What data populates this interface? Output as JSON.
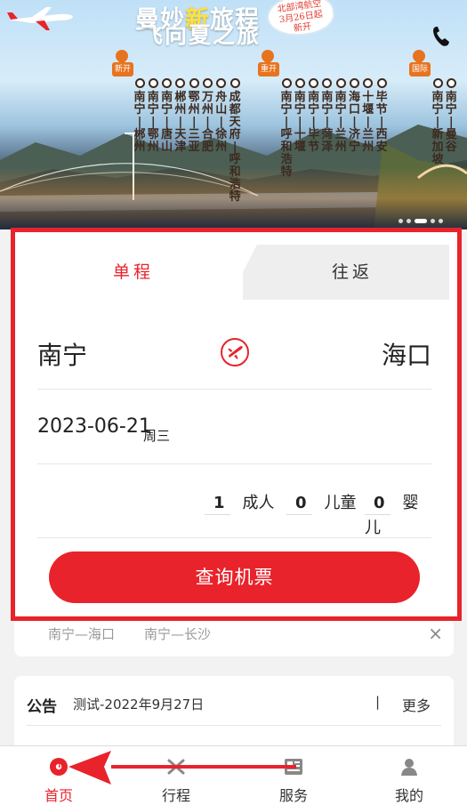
{
  "banner": {
    "slogan_a": "曼妙",
    "slogan_hl": "新",
    "slogan_b": "旅程",
    "slogan_line2": "飞向夏之旅",
    "badge_lines": [
      "北部湾航空",
      "3月26日起",
      "新开"
    ],
    "tags": [
      "新开",
      "重开",
      "国际"
    ],
    "routes_group1": [
      [
        "南",
        "宁",
        "|",
        "郴",
        "州"
      ],
      [
        "南",
        "宁",
        "|",
        "鄂",
        "州"
      ],
      [
        "南",
        "宁",
        "|",
        "唐",
        "山"
      ],
      [
        "郴",
        "州",
        "|",
        "天",
        "津"
      ],
      [
        "鄂",
        "州",
        "|",
        "三",
        "亚"
      ],
      [
        "万",
        "州",
        "|",
        "合",
        "肥"
      ],
      [
        "舟",
        "山",
        "|",
        "徐",
        "州"
      ],
      [
        "成",
        "都",
        "天",
        "府",
        "|",
        "呼",
        "和",
        "浩",
        "特"
      ]
    ],
    "routes_group2": [
      [
        "南",
        "宁",
        "|",
        "呼",
        "和",
        "浩",
        "特"
      ],
      [
        "南",
        "宁",
        "|",
        "十",
        "堰"
      ],
      [
        "南",
        "宁",
        "|",
        "毕",
        "节"
      ],
      [
        "南",
        "宁",
        "|",
        "菏",
        "泽"
      ],
      [
        "南",
        "宁",
        "|",
        "兰",
        "州"
      ],
      [
        "海",
        "口",
        "|",
        "济",
        "宁"
      ],
      [
        "十",
        "堰",
        "|",
        "兰",
        "州"
      ],
      [
        "毕",
        "节",
        "|",
        "西",
        "安"
      ]
    ],
    "routes_group3": [
      [
        "南",
        "宁",
        "|",
        "新",
        "加",
        "坡"
      ],
      [
        "南",
        "宁",
        "|",
        "曼",
        "谷"
      ]
    ]
  },
  "booking": {
    "tab_single": "单程",
    "tab_round": "往返",
    "from_city": "南宁",
    "to_city": "海口",
    "date": "2023-06-21",
    "weekday": "周三",
    "adults_count": "1",
    "adults_label": "成人",
    "children_count": "0",
    "children_label": "儿童",
    "infants_count": "0",
    "infants_label": "婴儿",
    "search_label": "查询机票"
  },
  "history": {
    "items": [
      "南宁—海口",
      "南宁—长沙"
    ],
    "close_glyph": "×"
  },
  "notice": {
    "label": "公告",
    "text": "测试-2022年9月27日",
    "separator": "|",
    "more": "更多"
  },
  "nav": {
    "items": [
      {
        "label": "首页",
        "icon": "home-icon",
        "active": true
      },
      {
        "label": "行程",
        "icon": "plane-icon",
        "active": false
      },
      {
        "label": "服务",
        "icon": "news-icon",
        "active": false
      },
      {
        "label": "我的",
        "icon": "user-icon",
        "active": false
      }
    ]
  },
  "colors": {
    "accent": "#e8232b",
    "banner_tag": "#e8731f"
  }
}
